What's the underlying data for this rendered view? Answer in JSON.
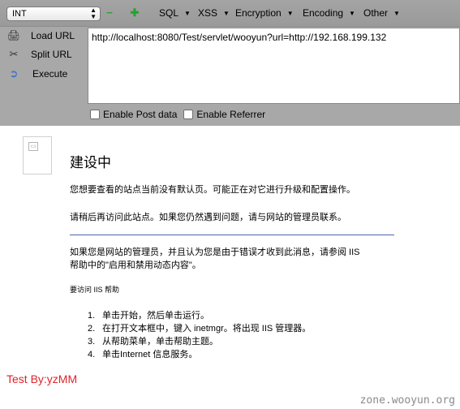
{
  "toolbar": {
    "select_value": "INT",
    "menus": [
      "SQL",
      "XSS",
      "Encryption",
      "Encoding",
      "Other"
    ],
    "actions": [
      {
        "label": "Load URL",
        "icon": "load-url-icon"
      },
      {
        "label": "Split URL",
        "icon": "split-url-icon"
      },
      {
        "label": "Execute",
        "icon": "execute-icon"
      }
    ],
    "url_value": "http://localhost:8080/Test/servlet/wooyun?url=http://192.168.199.132",
    "enable_post": "Enable Post data",
    "enable_referrer": "Enable Referrer"
  },
  "page": {
    "title": "建设中",
    "para1": "您想要查看的站点当前没有默认页。可能正在对它进行升级和配置操作。",
    "para2": "请稍后再访问此站点。如果您仍然遇到问题，请与网站的管理员联系。",
    "para3_line1": "如果您是网站的管理员，并且认为您是由于错误才收到此消息，请参阅 IIS",
    "para3_line2": "帮助中的\"启用和禁用动态内容\"。",
    "help_heading": "要访问 IIS 帮助",
    "steps": [
      {
        "num": "1.",
        "text": "单击开始，然后单击运行。"
      },
      {
        "num": "2.",
        "text": "在打开文本框中，键入 inetmgr。将出现 IIS 管理器。"
      },
      {
        "num": "3.",
        "text": "从帮助菜单，单击帮助主题。"
      },
      {
        "num": "4.",
        "text": "单击Internet 信息服务。"
      }
    ]
  },
  "test_by": "Test By:yzMM",
  "watermark": "zone.wooyun.org",
  "colors": {
    "accent": "#e0222a",
    "divider": "#4c66a8",
    "toolbar": "#a8a8a8"
  }
}
